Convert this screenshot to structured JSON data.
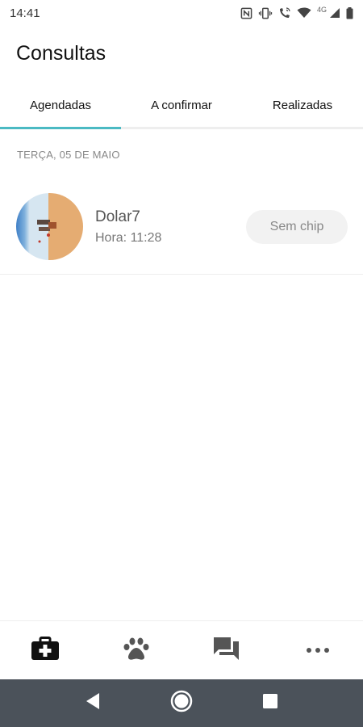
{
  "status_bar": {
    "time": "14:41",
    "network_label": "4G",
    "icons": [
      "nfc-icon",
      "vibrate-icon",
      "wifi-calling-icon",
      "wifi-icon",
      "cell-signal-icon",
      "battery-icon"
    ]
  },
  "header": {
    "title": "Consultas"
  },
  "tabs": [
    {
      "label": "Agendadas",
      "active": true
    },
    {
      "label": "A confirmar",
      "active": false
    },
    {
      "label": "Realizadas",
      "active": false
    }
  ],
  "appointments": {
    "date_label": "TERÇA, 05 DE MAIO",
    "items": [
      {
        "pet_name": "Dolar7",
        "time": "Hora: 11:28",
        "chip_status": "Sem chip"
      }
    ]
  },
  "bottom_nav": {
    "items": [
      {
        "icon": "medical-kit-icon",
        "active": true
      },
      {
        "icon": "paw-icon",
        "active": false
      },
      {
        "icon": "chat-icon",
        "active": false
      },
      {
        "icon": "more-icon",
        "active": false
      }
    ]
  },
  "system_nav": {
    "buttons": [
      "back-icon",
      "home-icon",
      "recents-icon"
    ]
  },
  "colors": {
    "accent": "#4bbac3",
    "system_nav_bg": "#4b525a",
    "badge_bg": "#f2f2f2"
  }
}
